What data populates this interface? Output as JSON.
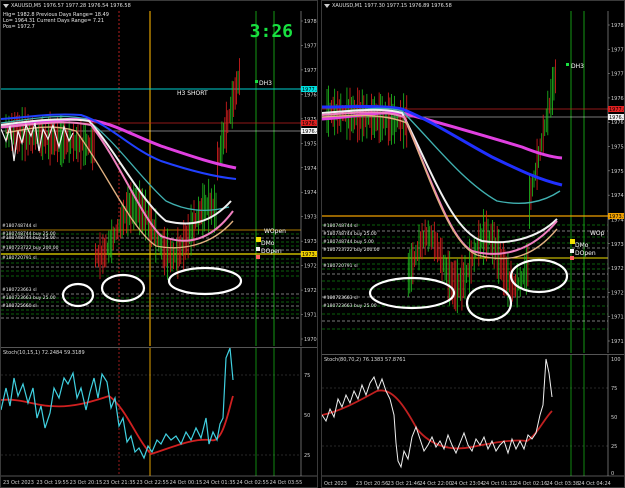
{
  "left": {
    "title": "XAUUSD,M5",
    "ohlc": "1976.57 1977.28 1976.54 1976.58",
    "info_lines": [
      "Hig= 1982.8    Previous Days Range= 18.49",
      "Lo= 1964.31    Current Days Range= 7.21",
      "Pos= 1972.7"
    ],
    "clock": "3:26",
    "h3_label": "H3 SHORT",
    "dh3_label": "DH3",
    "wopen_label": "WOpen",
    "dmo_label": "DMo",
    "dopen_label": "DOpen",
    "price_axis": [
      "1978.1",
      "1977.55",
      "1977.0",
      "1976.45",
      "1975.9",
      "1975.35",
      "1974.8",
      "1974.25",
      "1973.7",
      "1973.15",
      "1972.6",
      "1972.05",
      "1971.5",
      "1970.95"
    ],
    "price_tags": [
      {
        "label": "1977.20",
        "color": "#00e0e0"
      },
      {
        "label": "1976.58",
        "color": "#e02020"
      },
      {
        "label": "1976.45",
        "color": "#f0f0f0"
      },
      {
        "label": "1973.25",
        "color": "#f0d000"
      }
    ],
    "level_labels": [
      "#180748744 sl",
      "#180748744 buy 25.00",
      "#180748744 buy 25.00",
      "#180723722 buy 200.00",
      "#180720791 sl",
      "#180723663 sl",
      "#180723663 buy 25.00",
      "#180725660 sl"
    ],
    "stoch_label": "Stoch(10,15,1) 72.2484 59.3189",
    "stoch_axis": [
      "75",
      "50",
      "25"
    ],
    "time_axis": [
      "23 Oct 2023",
      "23 Oct 19:55",
      "23 Oct 20:15",
      "23 Oct 21:35",
      "23 Oct 22:55",
      "24 Oct 00:15",
      "24 Oct 01:35",
      "24 Oct 02:55",
      "24 Oct 03:55"
    ]
  },
  "right": {
    "title": "XAUUSD,M1",
    "ohlc": "1977.30 1977.15 1976.89 1976.58",
    "dh3_label": "DH3",
    "wopen_label": "WOp",
    "dmo_label": "DMo",
    "dopen_label": "DOpen",
    "price_axis": [
      "1978.40",
      "1977.85",
      "1977.30",
      "1976.75",
      "1976.20",
      "1975.65",
      "1975.10",
      "1974.55",
      "1974.00",
      "1973.45",
      "1972.90",
      "1972.35",
      "1971.80",
      "1971.25"
    ],
    "price_tags": [
      {
        "label": "1977.00",
        "color": "#e02020"
      },
      {
        "label": "1976.58",
        "color": "#f0f0f0"
      },
      {
        "label": "1973.90",
        "color": "#f0a000"
      }
    ],
    "level_labels": [
      "#180748744 sl",
      "#180748744 buy 25.00",
      "#180748744 buy 5.00",
      "#180723722 buy 200.00",
      "#180720791 sl",
      "#180723663 sl",
      "#180723663 buy 25.00"
    ],
    "stoch_label": "Stoch(80,70,2) 76.1383 57.8761",
    "stoch_axis": [
      "100",
      "75",
      "50",
      "25",
      "0"
    ],
    "time_axis": [
      "Oct 2023",
      "23 Oct 20:56",
      "23 Oct 21:46",
      "24 Oct 22:00",
      "24 Oct 23:04",
      "24 Oct 01:32",
      "24 Oct 02:16",
      "24 Oct 03:38",
      "24 Oct 04:24"
    ]
  }
}
